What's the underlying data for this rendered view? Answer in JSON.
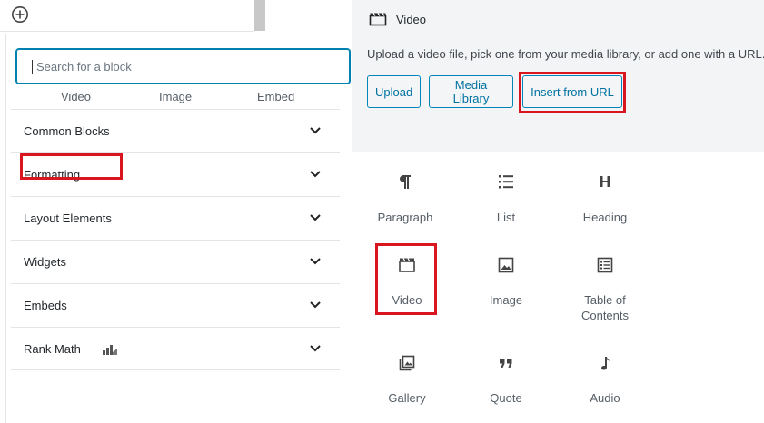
{
  "inserter": {
    "search_placeholder": "Search for a block",
    "peek_items": [
      "Video",
      "Image",
      "Embed"
    ],
    "sections": [
      "Common Blocks",
      "Formatting",
      "Layout Elements",
      "Widgets",
      "Embeds",
      "Rank Math"
    ]
  },
  "video_placeholder": {
    "title": "Video",
    "instructions": "Upload a video file, pick one from your media library, or add one with a URL.",
    "buttons": {
      "upload": "Upload",
      "media_library": "Media Library",
      "insert_from_url": "Insert from URL"
    }
  },
  "blocks": [
    {
      "label": "Paragraph",
      "icon": "paragraph-icon"
    },
    {
      "label": "List",
      "icon": "list-icon"
    },
    {
      "label": "Heading",
      "icon": "heading-icon"
    },
    {
      "label": "Video",
      "icon": "video-icon"
    },
    {
      "label": "Image",
      "icon": "image-icon"
    },
    {
      "label": "Table of Contents",
      "icon": "table-of-contents-icon"
    },
    {
      "label": "Gallery",
      "icon": "gallery-icon"
    },
    {
      "label": "Quote",
      "icon": "quote-icon"
    },
    {
      "label": "Audio",
      "icon": "audio-icon"
    }
  ],
  "colors": {
    "highlight": "#d9151f",
    "accent": "#0085ba",
    "panel_bg": "#f3f4f5"
  }
}
